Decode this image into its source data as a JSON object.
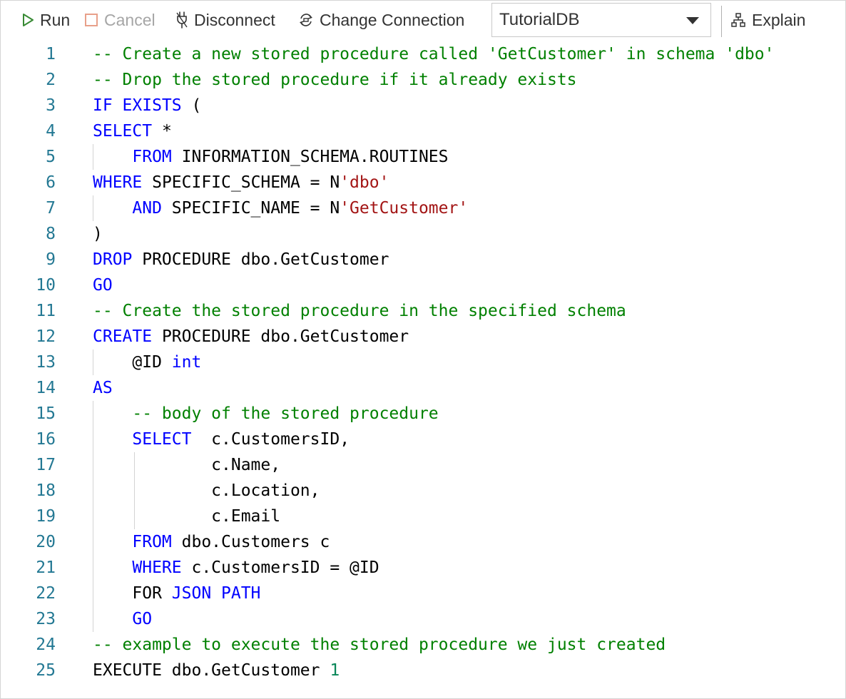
{
  "toolbar": {
    "run_label": "Run",
    "cancel_label": "Cancel",
    "disconnect_label": "Disconnect",
    "change_connection_label": "Change Connection",
    "database_selected": "TutorialDB",
    "explain_label": "Explain"
  },
  "colors": {
    "keyword": "#0000ff",
    "comment": "#008000",
    "string": "#a31515",
    "number": "#098658",
    "line_number": "#237893",
    "run_icon": "#388a34",
    "cancel_icon": "#e8a08a"
  },
  "icons": {
    "run": "play-icon",
    "cancel": "stop-icon",
    "disconnect": "unplug-icon",
    "change_connection": "swap-connection-icon",
    "explain": "hierarchy-icon",
    "dropdown": "chevron-down-icon"
  },
  "editor": {
    "lines": [
      {
        "n": "1",
        "tokens": [
          {
            "t": "-- Create a new stored procedure called 'GetCustomer' in schema 'dbo'",
            "c": "cm"
          }
        ]
      },
      {
        "n": "2",
        "tokens": [
          {
            "t": "-- Drop the stored procedure if it already exists",
            "c": "cm"
          }
        ]
      },
      {
        "n": "3",
        "tokens": [
          {
            "t": "IF EXISTS",
            "c": "kw"
          },
          {
            "t": " (",
            "c": ""
          }
        ]
      },
      {
        "n": "4",
        "tokens": [
          {
            "t": "SELECT",
            "c": "kw"
          },
          {
            "t": " *",
            "c": ""
          }
        ]
      },
      {
        "n": "5",
        "tokens": [
          {
            "t": "    ",
            "c": ""
          },
          {
            "t": "FROM",
            "c": "kw"
          },
          {
            "t": " INFORMATION_SCHEMA.ROUTINES",
            "c": ""
          }
        ]
      },
      {
        "n": "6",
        "tokens": [
          {
            "t": "WHERE",
            "c": "kw"
          },
          {
            "t": " SPECIFIC_SCHEMA = N",
            "c": ""
          },
          {
            "t": "'dbo'",
            "c": "st"
          }
        ]
      },
      {
        "n": "7",
        "tokens": [
          {
            "t": "    ",
            "c": ""
          },
          {
            "t": "AND",
            "c": "kw"
          },
          {
            "t": " SPECIFIC_NAME = N",
            "c": ""
          },
          {
            "t": "'GetCustomer'",
            "c": "st"
          }
        ]
      },
      {
        "n": "8",
        "tokens": [
          {
            "t": ")",
            "c": ""
          }
        ]
      },
      {
        "n": "9",
        "tokens": [
          {
            "t": "DROP",
            "c": "kw"
          },
          {
            "t": " PROCEDURE dbo.GetCustomer",
            "c": ""
          }
        ]
      },
      {
        "n": "10",
        "tokens": [
          {
            "t": "GO",
            "c": "kw"
          }
        ]
      },
      {
        "n": "11",
        "tokens": [
          {
            "t": "-- Create the stored procedure in the specified schema",
            "c": "cm"
          }
        ]
      },
      {
        "n": "12",
        "tokens": [
          {
            "t": "CREATE",
            "c": "kw"
          },
          {
            "t": " PROCEDURE dbo.GetCustomer",
            "c": ""
          }
        ]
      },
      {
        "n": "13",
        "tokens": [
          {
            "t": "    @ID ",
            "c": ""
          },
          {
            "t": "int",
            "c": "kw"
          }
        ]
      },
      {
        "n": "14",
        "tokens": [
          {
            "t": "AS",
            "c": "kw"
          }
        ]
      },
      {
        "n": "15",
        "tokens": [
          {
            "t": "    ",
            "c": ""
          },
          {
            "t": "-- body of the stored procedure",
            "c": "cm"
          }
        ]
      },
      {
        "n": "16",
        "tokens": [
          {
            "t": "    ",
            "c": ""
          },
          {
            "t": "SELECT",
            "c": "kw"
          },
          {
            "t": "  c.CustomersID,",
            "c": ""
          }
        ]
      },
      {
        "n": "17",
        "tokens": [
          {
            "t": "            c.Name,",
            "c": ""
          }
        ]
      },
      {
        "n": "18",
        "tokens": [
          {
            "t": "            c.Location,",
            "c": ""
          }
        ]
      },
      {
        "n": "19",
        "tokens": [
          {
            "t": "            c.Email",
            "c": ""
          }
        ]
      },
      {
        "n": "20",
        "tokens": [
          {
            "t": "    ",
            "c": ""
          },
          {
            "t": "FROM",
            "c": "kw"
          },
          {
            "t": " dbo.Customers c",
            "c": ""
          }
        ]
      },
      {
        "n": "21",
        "tokens": [
          {
            "t": "    ",
            "c": ""
          },
          {
            "t": "WHERE",
            "c": "kw"
          },
          {
            "t": " c.CustomersID = @ID",
            "c": ""
          }
        ]
      },
      {
        "n": "22",
        "tokens": [
          {
            "t": "    FOR ",
            "c": ""
          },
          {
            "t": "JSON PATH",
            "c": "kw"
          }
        ]
      },
      {
        "n": "23",
        "tokens": [
          {
            "t": "    ",
            "c": ""
          },
          {
            "t": "GO",
            "c": "kw"
          }
        ]
      },
      {
        "n": "24",
        "tokens": [
          {
            "t": "-- example to execute the stored procedure we just created",
            "c": "cm"
          }
        ]
      },
      {
        "n": "25",
        "tokens": [
          {
            "t": "EXECUTE dbo.GetCustomer ",
            "c": ""
          },
          {
            "t": "1",
            "c": "nm"
          }
        ]
      }
    ]
  }
}
